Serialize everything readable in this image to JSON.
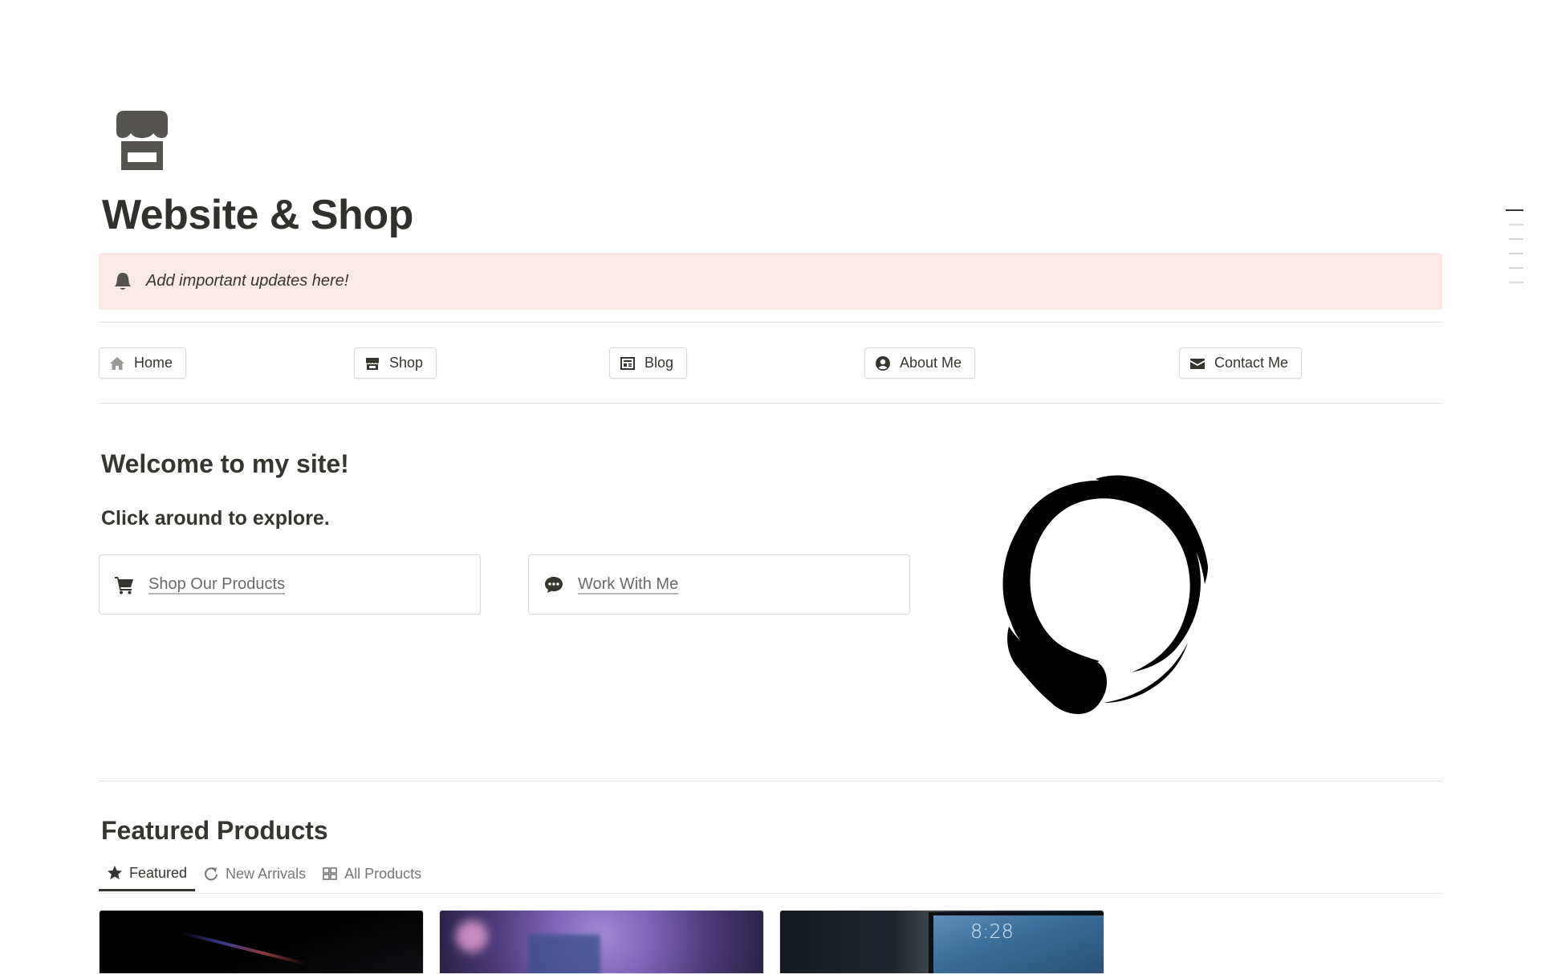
{
  "page": {
    "title": "Website & Shop",
    "icon": "storefront-icon"
  },
  "callout": {
    "icon": "bell-icon",
    "text": "Add important updates here!",
    "background": "#fbe9e8"
  },
  "nav": [
    {
      "label": "Home",
      "icon": "home-icon"
    },
    {
      "label": "Shop",
      "icon": "storefront-icon"
    },
    {
      "label": "Blog",
      "icon": "newspaper-icon"
    },
    {
      "label": "About Me",
      "icon": "user-circle-icon"
    },
    {
      "label": "Contact Me",
      "icon": "envelope-icon"
    }
  ],
  "welcome": {
    "heading": "Welcome to my site!",
    "subheading": "Click around to explore."
  },
  "cta": [
    {
      "label": "Shop Our Products",
      "icon": "cart-icon"
    },
    {
      "label": "Work With Me",
      "icon": "chat-bubble-icon"
    }
  ],
  "featured": {
    "heading": "Featured Products",
    "tabs": [
      {
        "label": "Featured",
        "icon": "star-icon",
        "active": true
      },
      {
        "label": "New Arrivals",
        "icon": "refresh-icon",
        "active": false
      },
      {
        "label": "All Products",
        "icon": "gallery-grid-icon",
        "active": false
      }
    ],
    "cards": [
      {
        "image": "laptop-dark-image"
      },
      {
        "image": "purple-device-image"
      },
      {
        "image": "tablet-lockscreen-image",
        "time": "8:28"
      }
    ]
  },
  "colors": {
    "text": "#37352f",
    "accent": "#37352f",
    "border": "#dcdad6"
  }
}
